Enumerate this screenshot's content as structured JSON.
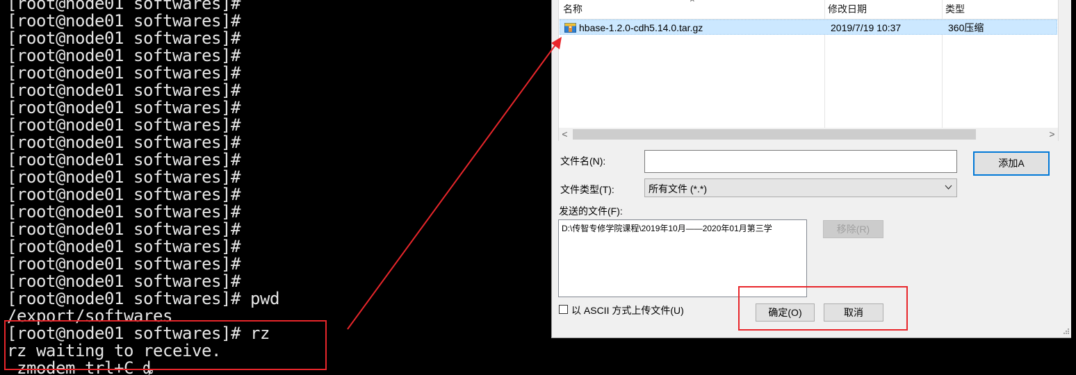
{
  "terminal": {
    "lines": [
      "[root@node01 softwares]#",
      "[root@node01 softwares]#",
      "[root@node01 softwares]#",
      "[root@node01 softwares]#",
      "[root@node01 softwares]#",
      "[root@node01 softwares]#",
      "[root@node01 softwares]#",
      "[root@node01 softwares]#",
      "[root@node01 softwares]#",
      "[root@node01 softwares]#",
      "[root@node01 softwares]#",
      "[root@node01 softwares]#",
      "[root@node01 softwares]#",
      "[root@node01 softwares]#",
      "[root@node01 softwares]#",
      "[root@node01 softwares]#",
      "[root@node01 softwares]#",
      "[root@node01 softwares]# pwd",
      "/export/softwares",
      "[root@node01 softwares]# rz",
      "rz waiting to receive.",
      " zmodem trl+C ȡ"
    ]
  },
  "dialog": {
    "file_list": {
      "columns": {
        "name": "名称",
        "date": "修改日期",
        "type": "类型"
      },
      "files": [
        {
          "name": "hbase-1.2.0-cdh5.14.0.tar.gz",
          "date": "2019/7/19 10:37",
          "type": "360压缩",
          "icon": "archive-icon"
        }
      ],
      "scroll_left": "<",
      "scroll_right": ">"
    },
    "filename": {
      "label": "文件名(N):",
      "value": ""
    },
    "filetype": {
      "label": "文件类型(T):",
      "value": "所有文件 (*.*)",
      "options": [
        "所有文件 (*.*)"
      ]
    },
    "add_button": "添加A",
    "sent_files": {
      "label": "发送的文件(F):",
      "items": [
        "D:\\传智专修学院课程\\2019年10月——2020年01月第三学"
      ]
    },
    "remove_button": "移除(R)",
    "ascii_checkbox": {
      "label": "以 ASCII 方式上传文件(U)",
      "checked": false
    },
    "ok_button": "确定(O)",
    "cancel_button": "取消"
  },
  "colors": {
    "annotation": "#e8262b",
    "selection": "#cce8ff",
    "focus": "#0078d7"
  }
}
